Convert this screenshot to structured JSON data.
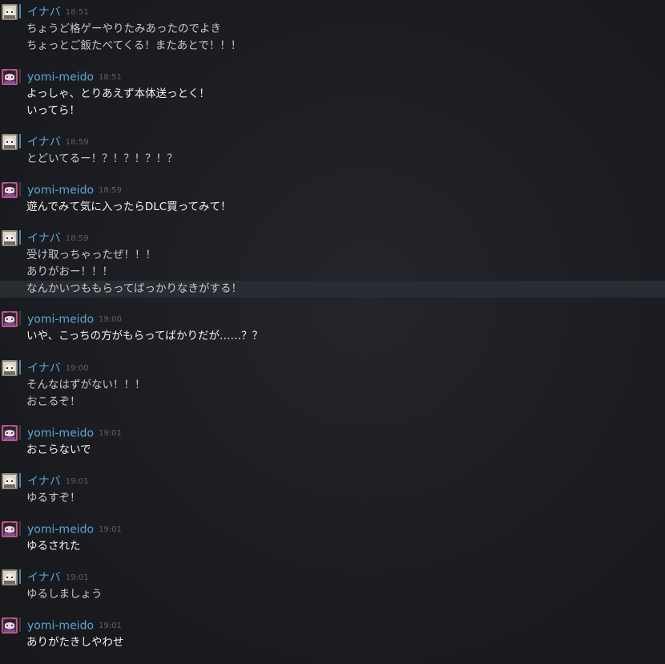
{
  "colors": {
    "background": "#1b1c20",
    "username": "#5aa7d3",
    "timestamp": "#5d6068",
    "inaba_text": "#c6c8cd",
    "yomi_text": "#f2f2f2",
    "inaba_bar": "#4a86ad",
    "yomi_bar": "#3b3f47",
    "highlight_row": "#2a2c33"
  },
  "messages": [
    {
      "user": "イナバ",
      "time": "18:51",
      "avatar": "inaba-avatar",
      "lines": [
        "ちょうど格ゲーやりたみあったのでよき",
        "ちょっとご飯たべてくる！またあとで！！！"
      ]
    },
    {
      "user": "yomi-meido",
      "time": "18:51",
      "avatar": "yomi-avatar",
      "lines": [
        "よっしゃ、とりあえず本体送っとく！",
        "いってら！"
      ]
    },
    {
      "user": "イナバ",
      "time": "18:59",
      "avatar": "inaba-avatar",
      "lines": [
        "とどいてるー！？！？！？！？"
      ]
    },
    {
      "user": "yomi-meido",
      "time": "18:59",
      "avatar": "yomi-avatar",
      "lines": [
        "遊んでみて気に入ったらDLC買ってみて！"
      ]
    },
    {
      "user": "イナバ",
      "time": "18:59",
      "avatar": "inaba-avatar",
      "lines": [
        "受け取っちゃったぜ！！！",
        "ありがおー！！！",
        "なんかいつももらってばっかりなきがする！"
      ]
    },
    {
      "user": "yomi-meido",
      "time": "19:00",
      "avatar": "yomi-avatar",
      "lines": [
        "いや、こっちの方がもらってばかりだが……？？"
      ]
    },
    {
      "user": "イナバ",
      "time": "19:00",
      "avatar": "inaba-avatar",
      "lines": [
        "そんなはずがない！！！",
        "おこるぞ！"
      ]
    },
    {
      "user": "yomi-meido",
      "time": "19:01",
      "avatar": "yomi-avatar",
      "lines": [
        "おこらないで"
      ]
    },
    {
      "user": "イナバ",
      "time": "19:01",
      "avatar": "inaba-avatar",
      "lines": [
        "ゆるすぞ！"
      ]
    },
    {
      "user": "yomi-meido",
      "time": "19:01",
      "avatar": "yomi-avatar",
      "lines": [
        "ゆるされた"
      ]
    },
    {
      "user": "イナバ",
      "time": "19:01",
      "avatar": "inaba-avatar",
      "lines": [
        "ゆるしましょう"
      ]
    },
    {
      "user": "yomi-meido",
      "time": "19:01",
      "avatar": "yomi-avatar",
      "lines": [
        "ありがたきしやわせ"
      ]
    }
  ]
}
